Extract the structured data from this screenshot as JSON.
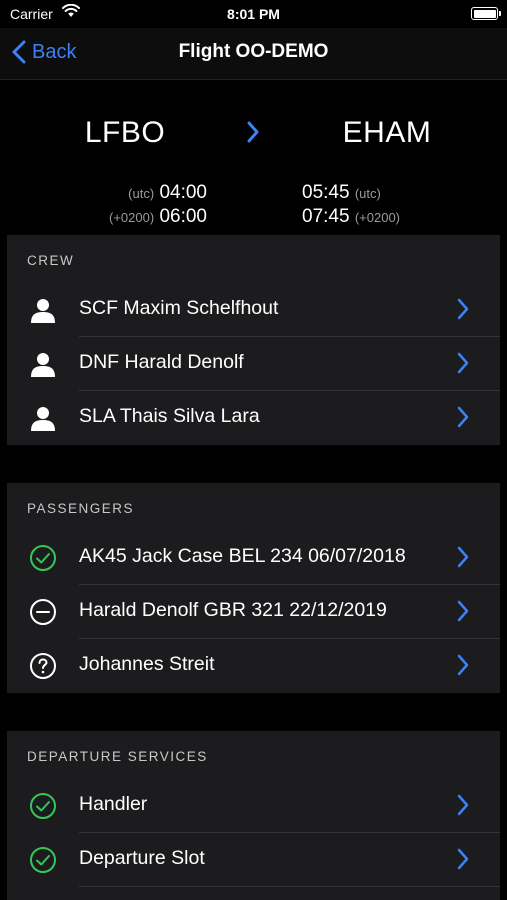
{
  "status_bar": {
    "carrier": "Carrier",
    "time": "8:01 PM"
  },
  "nav": {
    "back_label": "Back",
    "title": "Flight OO-DEMO"
  },
  "route": {
    "from": "LFBO",
    "to": "EHAM",
    "departure": {
      "utc_label": "(utc)",
      "utc_time": "04:00",
      "local_label": "(+0200)",
      "local_time": "06:00"
    },
    "arrival": {
      "utc_label": "(utc)",
      "utc_time": "05:45",
      "local_label": "(+0200)",
      "local_time": "07:45"
    }
  },
  "crew": {
    "header": "CREW",
    "items": [
      {
        "label": "SCF Maxim Schelfhout",
        "icon": "person-icon"
      },
      {
        "label": "DNF Harald Denolf",
        "icon": "person-icon"
      },
      {
        "label": "SLA Thais Silva Lara",
        "icon": "person-icon"
      }
    ]
  },
  "passengers": {
    "header": "PASSENGERS",
    "items": [
      {
        "label": "AK45 Jack Case BEL 234 06/07/2018",
        "icon": "checkmark-circle-icon"
      },
      {
        "label": "Harald Denolf GBR 321 22/12/2019",
        "icon": "minus-circle-icon"
      },
      {
        "label": "Johannes Streit",
        "icon": "question-circle-icon"
      }
    ]
  },
  "departure_services": {
    "header": "DEPARTURE SERVICES",
    "items": [
      {
        "label": "Handler",
        "icon": "checkmark-circle-icon"
      },
      {
        "label": "Departure Slot",
        "icon": "checkmark-circle-icon"
      }
    ]
  },
  "colors": {
    "accent": "#3b82f6",
    "success": "#34c759",
    "background": "#000000",
    "cell": "#1c1c1e"
  }
}
